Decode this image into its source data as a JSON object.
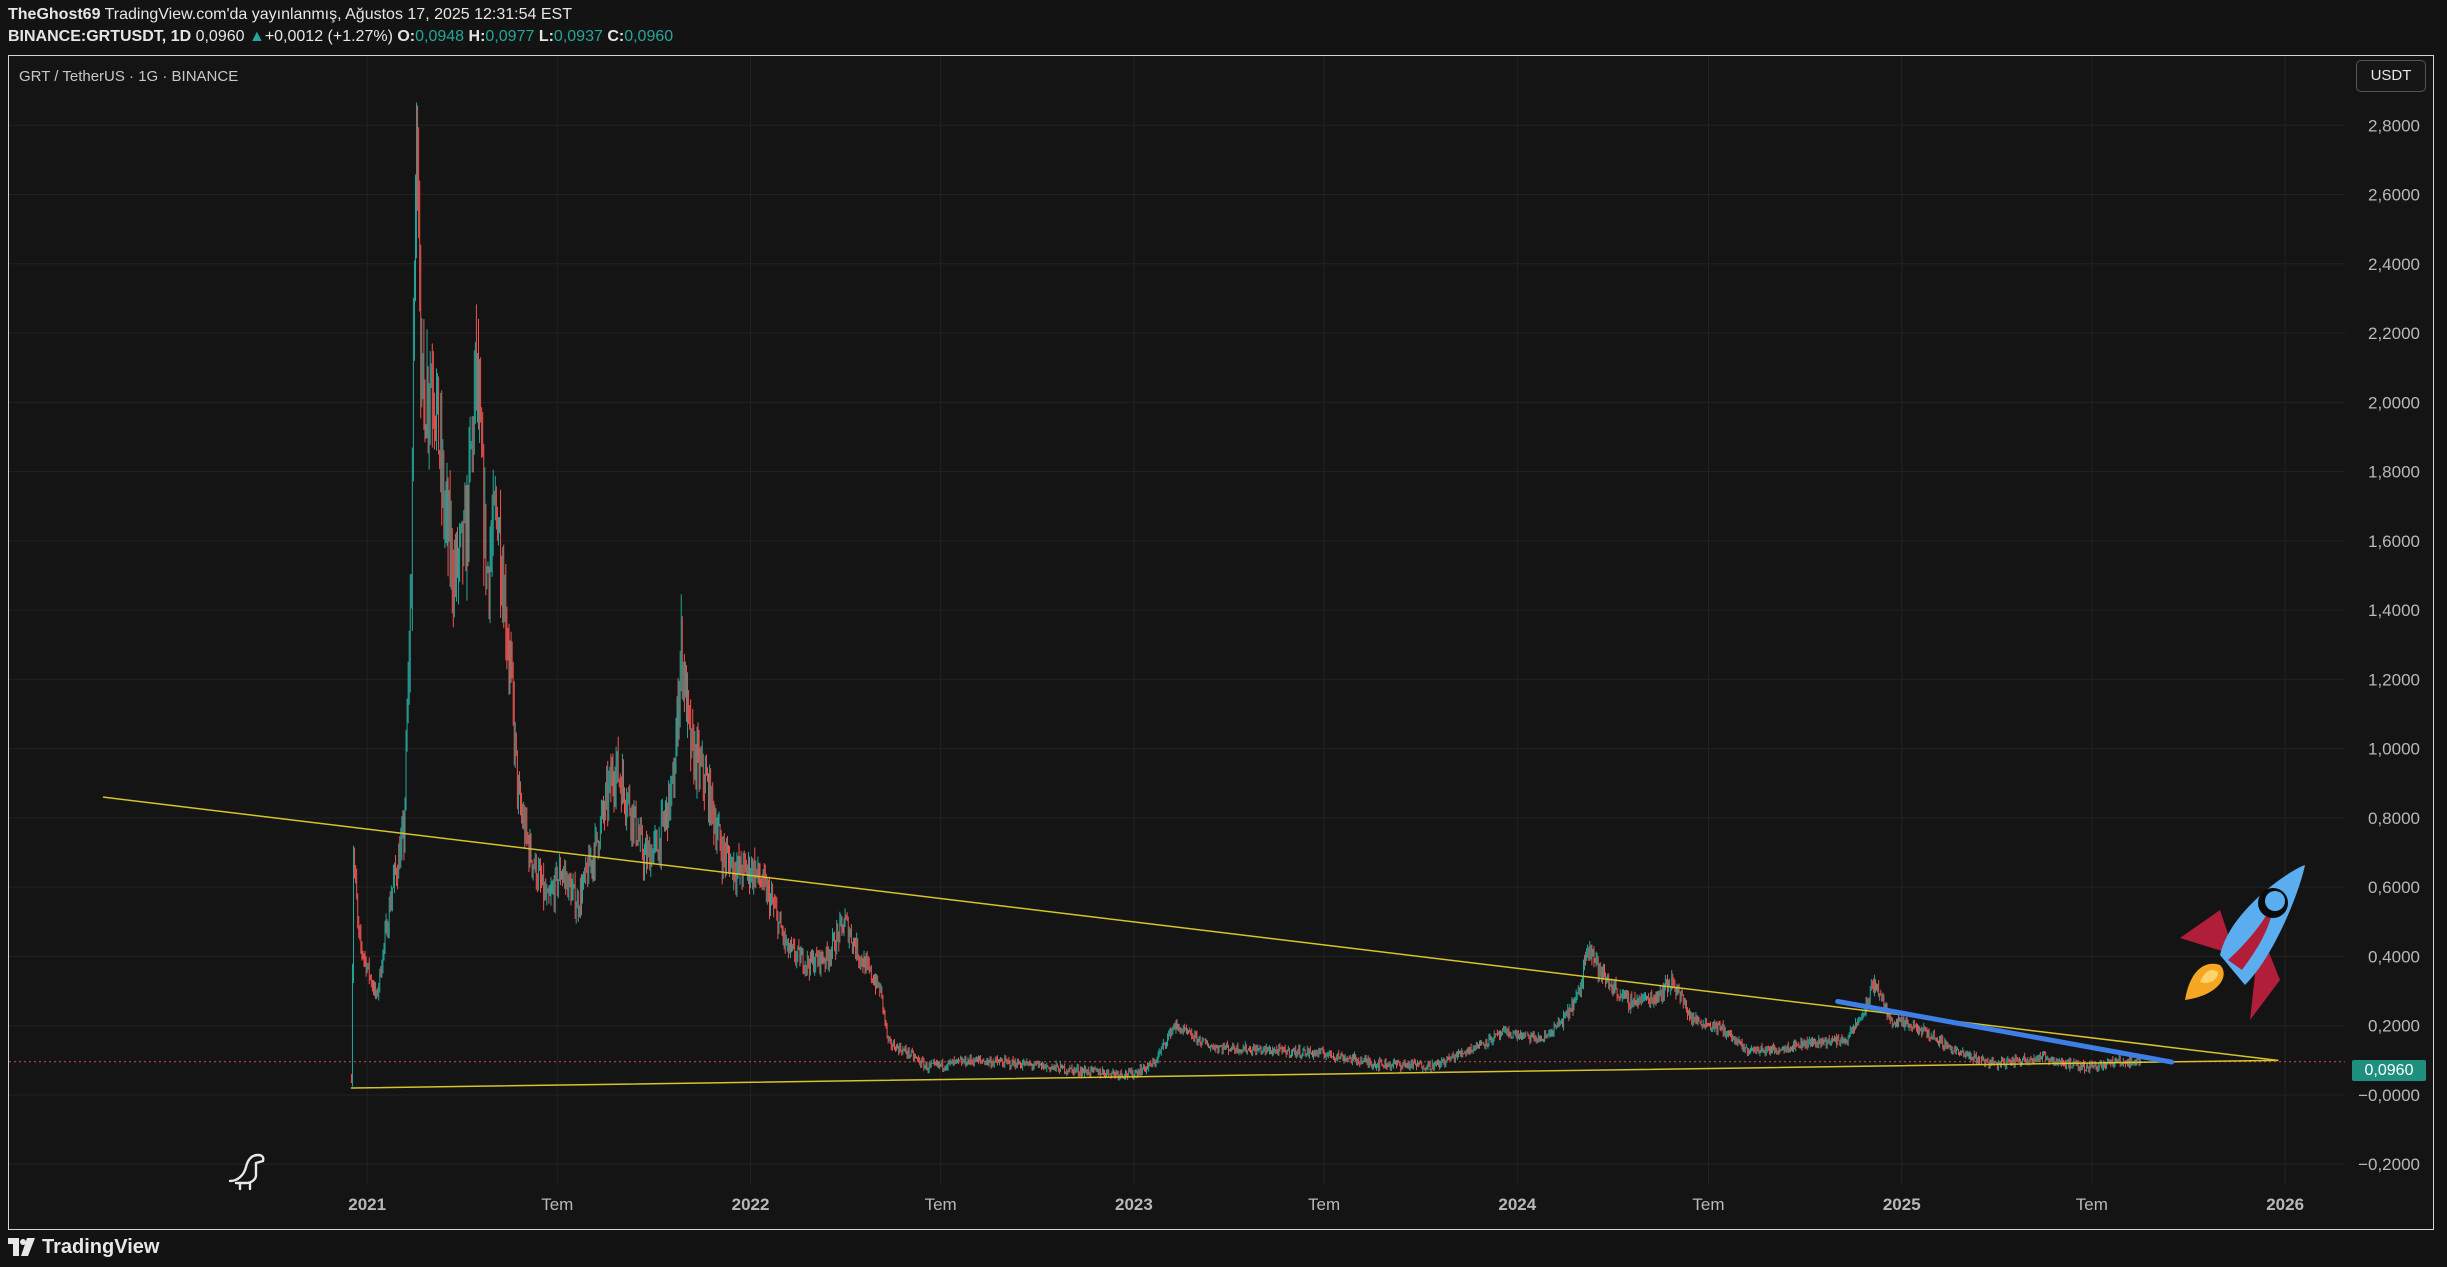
{
  "header": {
    "author": "TheGhost69",
    "published": "TradingView.com'da yayınlanmış, Ağustos 17, 2025 12:31:54 EST",
    "symbol": "BINANCE:GRTUSDT, 1D",
    "last": "0,0960",
    "change": "+0,0012 (+1.27%)",
    "o_label": "O:",
    "o": "0,0948",
    "h_label": "H:",
    "h": "0,0977",
    "l_label": "L:",
    "l": "0,0937",
    "c_label": "C:",
    "c": "0,0960"
  },
  "pair_title": "GRT / TetherUS · 1G · BINANCE",
  "currency_button": "USDT",
  "last_price_tag": "0,0960",
  "footer": {
    "brand": "TradingView"
  },
  "colors": {
    "up": "#26a69a",
    "down": "#ef5350",
    "trendline": "#d8c32a",
    "blue_line": "#3d7fe6",
    "price_line": "#c85050",
    "rocket_body": "#5aaef0",
    "rocket_fin": "#b01e3a",
    "flame": "#f5a623"
  },
  "icons": [
    "dino-icon",
    "rocket-icon",
    "tradingview-logo-icon"
  ],
  "chart_data": {
    "type": "candlestick",
    "interval": "1D",
    "ylim": [
      -0.26,
      3.0
    ],
    "y_ticks": [
      {
        "v": 2.8,
        "label": "2,8000"
      },
      {
        "v": 2.6,
        "label": "2,6000"
      },
      {
        "v": 2.4,
        "label": "2,4000"
      },
      {
        "v": 2.2,
        "label": "2,2000"
      },
      {
        "v": 2.0,
        "label": "2,0000"
      },
      {
        "v": 1.8,
        "label": "1,8000"
      },
      {
        "v": 1.6,
        "label": "1,6000"
      },
      {
        "v": 1.4,
        "label": "1,4000"
      },
      {
        "v": 1.2,
        "label": "1,2000"
      },
      {
        "v": 1.0,
        "label": "1,0000"
      },
      {
        "v": 0.8,
        "label": "0,8000"
      },
      {
        "v": 0.6,
        "label": "0,6000"
      },
      {
        "v": 0.4,
        "label": "0,4000"
      },
      {
        "v": 0.2,
        "label": "0,2000"
      },
      {
        "v": 0.0,
        "label": "−0,0000"
      },
      {
        "v": -0.2,
        "label": "−0,2000"
      }
    ],
    "x_ticks": [
      {
        "date": "2021-01-01",
        "label": "2021"
      },
      {
        "date": "2021-07-01",
        "label": "Tem"
      },
      {
        "date": "2022-01-01",
        "label": "2022"
      },
      {
        "date": "2022-07-01",
        "label": "Tem"
      },
      {
        "date": "2023-01-01",
        "label": "2023"
      },
      {
        "date": "2023-07-01",
        "label": "Tem"
      },
      {
        "date": "2024-01-01",
        "label": "2024"
      },
      {
        "date": "2024-07-01",
        "label": "Tem"
      },
      {
        "date": "2025-01-01",
        "label": "2025"
      },
      {
        "date": "2025-07-01",
        "label": "Tem"
      },
      {
        "date": "2026-01-01",
        "label": "2026"
      }
    ],
    "x_range": [
      "2020-01-26",
      "2026-02-27"
    ],
    "price_path": [
      [
        "2020-12-17",
        0.05
      ],
      [
        "2020-12-19",
        0.7
      ],
      [
        "2020-12-24",
        0.45
      ],
      [
        "2021-01-10",
        0.28
      ],
      [
        "2021-01-25",
        0.6
      ],
      [
        "2021-02-05",
        0.75
      ],
      [
        "2021-02-12",
        1.5
      ],
      [
        "2021-02-15",
        2.4
      ],
      [
        "2021-02-18",
        2.85
      ],
      [
        "2021-02-22",
        2.0
      ],
      [
        "2021-03-05",
        2.1
      ],
      [
        "2021-03-15",
        1.7
      ],
      [
        "2021-03-25",
        1.5
      ],
      [
        "2021-04-05",
        1.6
      ],
      [
        "2021-04-15",
        2.1
      ],
      [
        "2021-04-25",
        1.5
      ],
      [
        "2021-05-05",
        1.7
      ],
      [
        "2021-05-18",
        1.2
      ],
      [
        "2021-05-25",
        0.85
      ],
      [
        "2021-06-05",
        0.7
      ],
      [
        "2021-06-22",
        0.55
      ],
      [
        "2021-07-05",
        0.65
      ],
      [
        "2021-07-20",
        0.55
      ],
      [
        "2021-08-05",
        0.7
      ],
      [
        "2021-08-25",
        0.95
      ],
      [
        "2021-09-07",
        0.85
      ],
      [
        "2021-09-22",
        0.68
      ],
      [
        "2021-10-05",
        0.72
      ],
      [
        "2021-10-20",
        0.9
      ],
      [
        "2021-10-27",
        1.3
      ],
      [
        "2021-11-05",
        1.0
      ],
      [
        "2021-11-20",
        0.9
      ],
      [
        "2021-12-05",
        0.7
      ],
      [
        "2021-12-20",
        0.65
      ],
      [
        "2022-01-05",
        0.65
      ],
      [
        "2022-01-22",
        0.55
      ],
      [
        "2022-02-05",
        0.42
      ],
      [
        "2022-02-25",
        0.38
      ],
      [
        "2022-03-15",
        0.4
      ],
      [
        "2022-04-01",
        0.5
      ],
      [
        "2022-04-15",
        0.4
      ],
      [
        "2022-05-05",
        0.3
      ],
      [
        "2022-05-12",
        0.15
      ],
      [
        "2022-06-01",
        0.12
      ],
      [
        "2022-06-18",
        0.08
      ],
      [
        "2022-08-01",
        0.1
      ],
      [
        "2022-09-15",
        0.09
      ],
      [
        "2022-11-10",
        0.07
      ],
      [
        "2022-12-30",
        0.06
      ],
      [
        "2023-01-20",
        0.09
      ],
      [
        "2023-02-08",
        0.2
      ],
      [
        "2023-03-15",
        0.14
      ],
      [
        "2023-05-01",
        0.13
      ],
      [
        "2023-07-01",
        0.12
      ],
      [
        "2023-08-20",
        0.09
      ],
      [
        "2023-10-15",
        0.085
      ],
      [
        "2023-11-15",
        0.13
      ],
      [
        "2023-12-20",
        0.18
      ],
      [
        "2024-01-25",
        0.16
      ],
      [
        "2024-02-15",
        0.22
      ],
      [
        "2024-03-01",
        0.3
      ],
      [
        "2024-03-08",
        0.45
      ],
      [
        "2024-03-20",
        0.35
      ],
      [
        "2024-04-15",
        0.27
      ],
      [
        "2024-05-10",
        0.28
      ],
      [
        "2024-05-28",
        0.33
      ],
      [
        "2024-06-15",
        0.22
      ],
      [
        "2024-07-15",
        0.19
      ],
      [
        "2024-08-05",
        0.13
      ],
      [
        "2024-09-01",
        0.13
      ],
      [
        "2024-10-01",
        0.15
      ],
      [
        "2024-11-10",
        0.16
      ],
      [
        "2024-11-28",
        0.25
      ],
      [
        "2024-12-06",
        0.33
      ],
      [
        "2024-12-20",
        0.22
      ],
      [
        "2025-01-25",
        0.18
      ],
      [
        "2025-02-25",
        0.12
      ],
      [
        "2025-04-01",
        0.09
      ],
      [
        "2025-05-15",
        0.11
      ],
      [
        "2025-06-20",
        0.08
      ],
      [
        "2025-07-25",
        0.095
      ],
      [
        "2025-08-17",
        0.096
      ]
    ],
    "drawings": [
      {
        "name": "upper-trendline",
        "from": [
          "2020-04-25",
          0.86
        ],
        "to": [
          "2025-12-25",
          0.1
        ]
      },
      {
        "name": "lower-trendline",
        "from": [
          "2020-12-17",
          0.02
        ],
        "to": [
          "2025-12-25",
          0.1
        ]
      },
      {
        "name": "blue-trendline",
        "from": [
          "2024-11-01",
          0.27
        ],
        "to": [
          "2025-09-15",
          0.095
        ]
      }
    ],
    "last_price": 0.096
  }
}
